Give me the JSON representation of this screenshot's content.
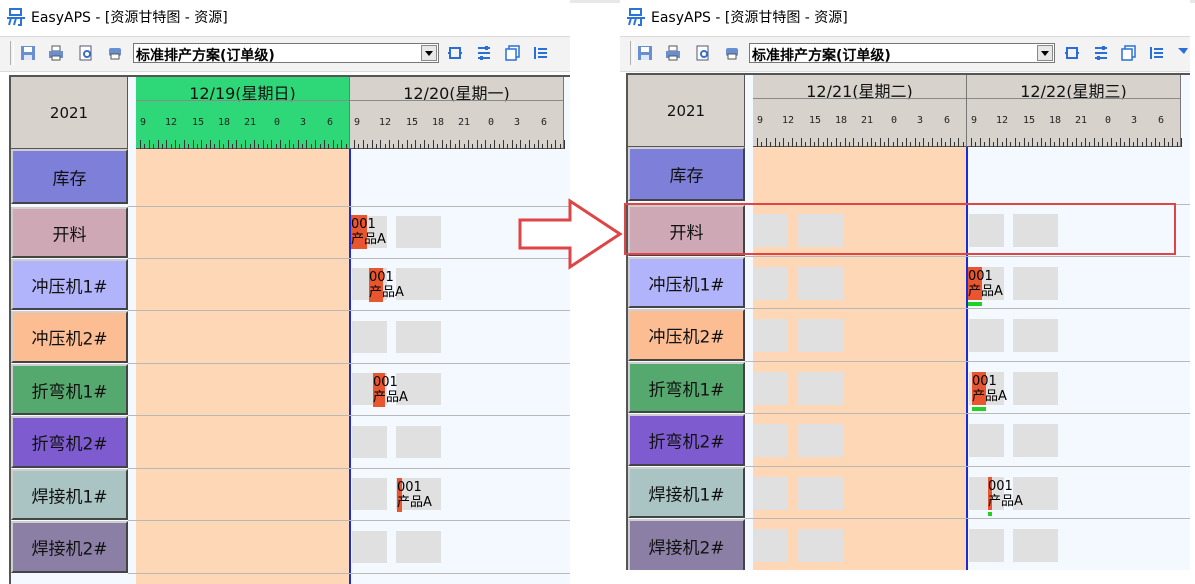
{
  "left": {
    "title": "EasyAPS - [资源甘特图 - 资源]",
    "scheme": "标准排产方案(订单级)",
    "year": "2021",
    "days": [
      {
        "label": "12/19(星期日)",
        "highlight": true
      },
      {
        "label": "12/20(星期一)",
        "highlight": false
      }
    ],
    "tick_labels": [
      "9",
      "12",
      "15",
      "18",
      "21",
      "0",
      "3",
      "6"
    ],
    "rows": [
      "库存",
      "开料",
      "冲压机1#",
      "冲压机2#",
      "折弯机1#",
      "折弯机2#",
      "焊接机1#",
      "焊接机2#"
    ],
    "tasks": [
      {
        "code": "001",
        "product": "产品A"
      },
      {
        "code": "001",
        "product": "产品A"
      },
      {
        "code": "001",
        "product": "产品A"
      },
      {
        "code": "001",
        "product": "产品A"
      }
    ]
  },
  "right": {
    "title": "EasyAPS - [资源甘特图 - 资源]",
    "scheme": "标准排产方案(订单级)",
    "year": "2021",
    "days": [
      {
        "label": "12/21(星期二)",
        "highlight": false
      },
      {
        "label": "12/22(星期三)",
        "highlight": false
      }
    ],
    "tick_labels": [
      "9",
      "12",
      "15",
      "18",
      "21",
      "0",
      "3",
      "6"
    ],
    "rows": [
      "库存",
      "开料",
      "冲压机1#",
      "冲压机2#",
      "折弯机1#",
      "折弯机2#",
      "焊接机1#",
      "焊接机2#"
    ],
    "tasks": [
      {
        "code": "001",
        "product": "产品A"
      },
      {
        "code": "001",
        "product": "产品A"
      },
      {
        "code": "001",
        "product": "产品A"
      }
    ]
  },
  "colors": {
    "row_labels": [
      "#7d7fd9",
      "#cfa8b6",
      "#b2b4fb",
      "#fdbd92",
      "#55a86e",
      "#7e5bcf",
      "#a9c4c3",
      "#8c7fa6"
    ],
    "day_highlight": "#2ed879",
    "shade": "#fdd7b6",
    "task": "#e8562f",
    "progress": "#22d022",
    "current_time_line": "#1a2bd8",
    "annotation": "#e04545"
  },
  "icons": [
    "app-logo-icon",
    "save-icon",
    "print-icon",
    "preview-icon",
    "print-setup-icon",
    "chevron-down-icon",
    "refresh-icon",
    "list-icon",
    "copy-icon",
    "indent-icon",
    "filter-icon",
    "right-arrow-icon"
  ]
}
